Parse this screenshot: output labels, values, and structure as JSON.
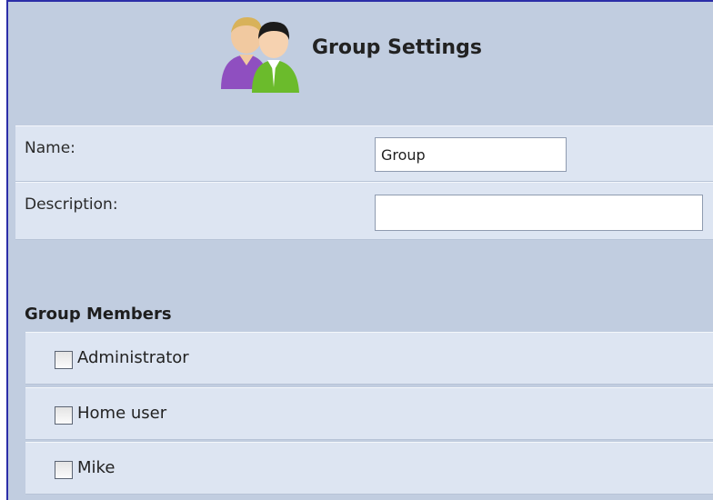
{
  "header": {
    "title": "Group Settings",
    "icon": "group-users-icon"
  },
  "form": {
    "name_label": "Name:",
    "name_value": "Group",
    "description_label": "Description:",
    "description_value": ""
  },
  "members": {
    "title": "Group Members",
    "items": [
      {
        "label": "Administrator",
        "checked": false
      },
      {
        "label": "Home user",
        "checked": false
      },
      {
        "label": "Mike",
        "checked": false
      }
    ]
  },
  "colors": {
    "frame_border": "#2c2ea8",
    "background": "#c1cde0",
    "row_background": "#dde5f2"
  }
}
